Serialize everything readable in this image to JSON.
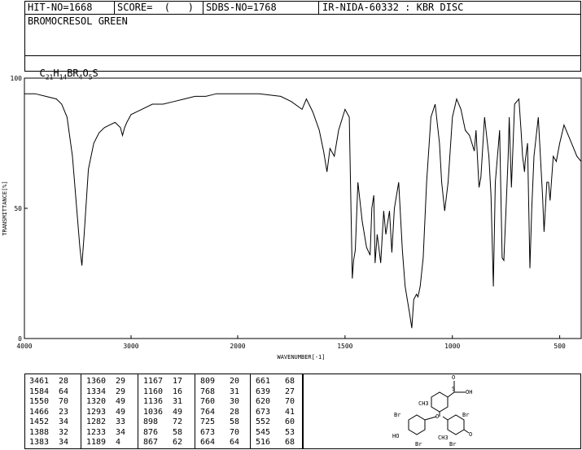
{
  "header": {
    "hit_no": "HIT-NO=1668",
    "score": "SCORE=  (   )",
    "sdbs_no": "SDBS-NO=1768",
    "ir_info": "IR-NIDA-60332 : KBR DISC",
    "compound_name": "BROMOCRESOL GREEN",
    "formula": {
      "parts": [
        "C",
        "21",
        "H",
        "14",
        "BR",
        "4",
        "O",
        "5",
        "S"
      ]
    }
  },
  "chart_data": {
    "type": "line",
    "title": "",
    "xlabel": "WAVENUMBER[-1]",
    "ylabel": "TRANSMITTANCE[%]",
    "xlim": [
      4000,
      400
    ],
    "ylim": [
      0,
      100
    ],
    "x_ticks": [
      4000,
      3000,
      2000,
      1500,
      1000,
      500
    ],
    "y_ticks": [
      0,
      50,
      100
    ],
    "grid": false,
    "series": [
      {
        "x": [
          4000,
          3900,
          3800,
          3700,
          3650,
          3600,
          3550,
          3500,
          3480,
          3461,
          3440,
          3400,
          3350,
          3300,
          3250,
          3200,
          3150,
          3100,
          3080,
          3060,
          3040,
          3000,
          2950,
          2900,
          2800,
          2700,
          2600,
          2500,
          2400,
          2300,
          2200,
          2100,
          2000,
          1900,
          1800,
          1750,
          1700,
          1680,
          1650,
          1620,
          1600,
          1584,
          1570,
          1550,
          1530,
          1500,
          1480,
          1466,
          1460,
          1452,
          1440,
          1420,
          1400,
          1383,
          1375,
          1366,
          1360,
          1350,
          1334,
          1320,
          1310,
          1293,
          1282,
          1270,
          1250,
          1233,
          1220,
          1200,
          1189,
          1180,
          1167,
          1160,
          1150,
          1136,
          1120,
          1100,
          1080,
          1060,
          1050,
          1036,
          1020,
          1000,
          980,
          960,
          940,
          920,
          898,
          890,
          876,
          867,
          850,
          830,
          820,
          809,
          800,
          780,
          768,
          760,
          750,
          740,
          735,
          725,
          710,
          690,
          680,
          673,
          664,
          661,
          650,
          639,
          630,
          620,
          600,
          580,
          573,
          560,
          552,
          545,
          530,
          516,
          500,
          480,
          460,
          440,
          420,
          400
        ],
        "y": [
          94,
          94,
          93,
          92,
          90,
          85,
          70,
          45,
          35,
          28,
          40,
          65,
          75,
          79,
          81,
          82,
          83,
          81,
          78,
          81,
          83,
          86,
          87,
          88,
          90,
          90,
          91,
          92,
          93,
          93,
          94,
          94,
          94,
          94,
          93,
          91,
          88,
          92,
          87,
          80,
          72,
          64,
          73,
          70,
          80,
          88,
          85,
          23,
          30,
          34,
          60,
          45,
          35,
          32,
          50,
          55,
          29,
          40,
          29,
          49,
          40,
          49,
          33,
          50,
          60,
          34,
          20,
          10,
          4,
          15,
          17,
          16,
          20,
          31,
          60,
          85,
          90,
          75,
          60,
          49,
          60,
          85,
          92,
          88,
          80,
          78,
          72,
          80,
          58,
          62,
          85,
          70,
          55,
          20,
          60,
          80,
          31,
          30,
          50,
          70,
          85,
          58,
          90,
          92,
          80,
          70,
          64,
          68,
          75,
          27,
          50,
          70,
          85,
          55,
          41,
          60,
          60,
          53,
          70,
          68,
          75,
          82,
          78,
          74,
          70,
          68
        ]
      }
    ],
    "peak_table": [
      [
        [
          "3461",
          "28"
        ],
        [
          "1584",
          "64"
        ],
        [
          "1550",
          "70"
        ],
        [
          "1466",
          "23"
        ],
        [
          "1452",
          "34"
        ],
        [
          "1388",
          "32"
        ],
        [
          "1383",
          "34"
        ]
      ],
      [
        [
          "1360",
          "29"
        ],
        [
          "1334",
          "29"
        ],
        [
          "1320",
          "49"
        ],
        [
          "1293",
          "49"
        ],
        [
          "1282",
          "33"
        ],
        [
          "1233",
          "34"
        ],
        [
          "1189",
          "4"
        ]
      ],
      [
        [
          "1167",
          "17"
        ],
        [
          "1160",
          "16"
        ],
        [
          "1136",
          "31"
        ],
        [
          "1036",
          "49"
        ],
        [
          "898",
          "72"
        ],
        [
          "876",
          "58"
        ],
        [
          "867",
          "62"
        ]
      ],
      [
        [
          "809",
          "20"
        ],
        [
          "768",
          "31"
        ],
        [
          "760",
          "30"
        ],
        [
          "764",
          "28"
        ],
        [
          "725",
          "58"
        ],
        [
          "673",
          "70"
        ],
        [
          "664",
          "64"
        ]
      ],
      [
        [
          "661",
          "68"
        ],
        [
          "639",
          "27"
        ],
        [
          "620",
          "70"
        ],
        [
          "673",
          "41"
        ],
        [
          "552",
          "60"
        ],
        [
          "545",
          "53"
        ],
        [
          "516",
          "68"
        ]
      ]
    ]
  },
  "structure": {
    "labels": [
      "Br",
      "CH3",
      "HO",
      "Br",
      "Br",
      "CH3",
      "Br",
      "O",
      "O",
      "O",
      "S",
      "OH"
    ]
  }
}
